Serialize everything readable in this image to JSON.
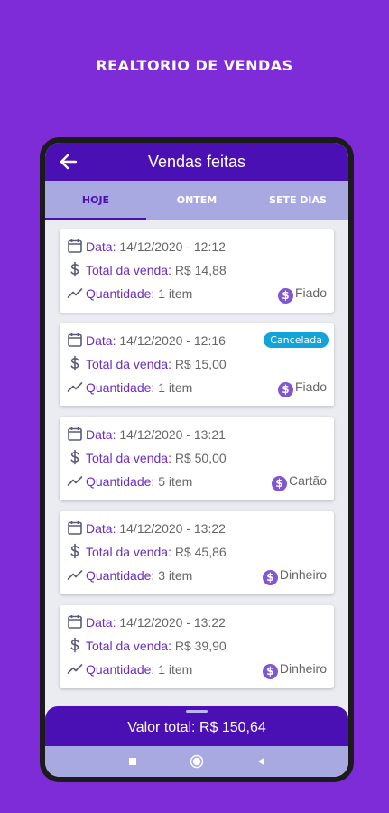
{
  "promo": {
    "title": "REALTORIO DE VENDAS"
  },
  "appbar": {
    "title": "Vendas feitas"
  },
  "tabs": [
    {
      "label": "HOJE",
      "active": true
    },
    {
      "label": "ONTEM",
      "active": false
    },
    {
      "label": "SETE DIAS",
      "active": false
    }
  ],
  "labels": {
    "date": "Data:",
    "total": "Total da venda:",
    "quantity": "Quantidade:"
  },
  "sales": [
    {
      "date": "14/12/2020 - 12:12",
      "total": "R$ 14,88",
      "quantity": "1 item",
      "payment": "Fiado",
      "badge": ""
    },
    {
      "date": "14/12/2020 - 12:16",
      "total": "R$ 15,00",
      "quantity": "1 item",
      "payment": "Fiado",
      "badge": "Cancelada"
    },
    {
      "date": "14/12/2020 - 13:21",
      "total": "R$ 50,00",
      "quantity": "5 item",
      "payment": "Cartão",
      "badge": ""
    },
    {
      "date": "14/12/2020 - 13:22",
      "total": "R$ 45,86",
      "quantity": "3 item",
      "payment": "Dinheiro",
      "badge": ""
    },
    {
      "date": "14/12/2020 - 13:22",
      "total": "R$ 39,90",
      "quantity": "1 item",
      "payment": "Dinheiro",
      "badge": ""
    }
  ],
  "summary": {
    "total": "Valor total: R$ 150,64"
  },
  "colors": {
    "primary": "#4a10b4",
    "background": "#7e2bd8",
    "tabbar": "#a9a9e2",
    "badge": "#12a4d8",
    "label": "#6a2ec6"
  },
  "icons": {
    "back": "arrow-left-icon",
    "date": "calendar-icon",
    "total": "dollar-icon",
    "quantity": "trending-up-icon",
    "payment": "coin-icon"
  }
}
